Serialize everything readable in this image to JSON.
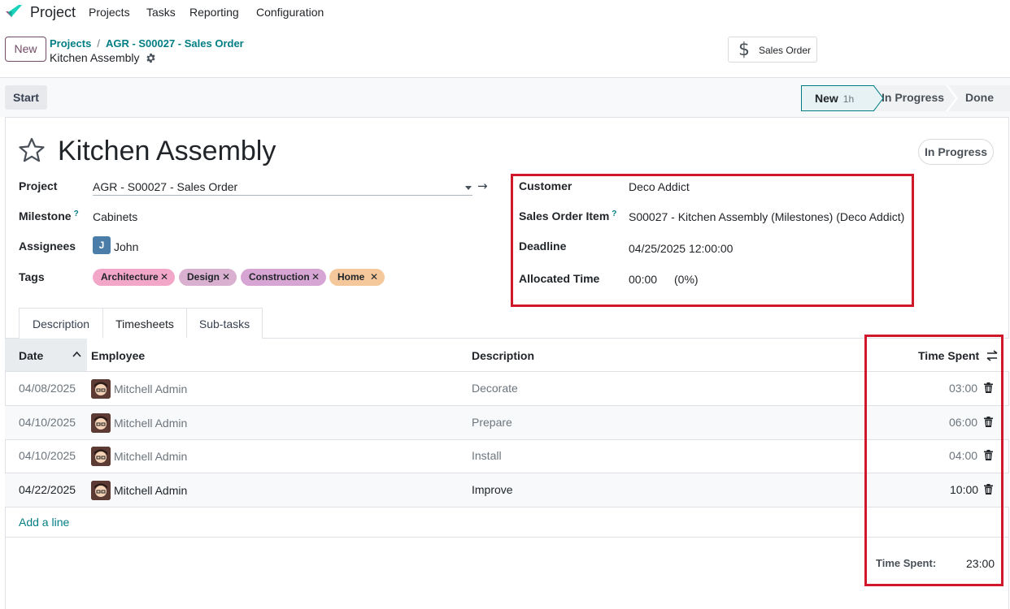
{
  "app": {
    "name": "Project"
  },
  "nav": {
    "items": [
      "Projects",
      "Tasks",
      "Reporting",
      "Configuration"
    ]
  },
  "control": {
    "new_label": "New",
    "breadcrumb": [
      "Projects",
      "AGR - S00027 - Sales Order"
    ],
    "current": "Kitchen Assembly",
    "sales_order_button": "Sales Order"
  },
  "statusbar": {
    "start_label": "Start",
    "stages": [
      {
        "label": "New",
        "duration": "1h",
        "active": true
      },
      {
        "label": "In Progress",
        "active": false
      },
      {
        "label": "Done",
        "active": false
      }
    ]
  },
  "task": {
    "title": "Kitchen Assembly",
    "status_pill": "In Progress",
    "fields": {
      "project_label": "Project",
      "project_value": "AGR - S00027 - Sales Order",
      "milestone_label": "Milestone",
      "milestone_help": "?",
      "milestone_value": "Cabinets",
      "assignees_label": "Assignees",
      "assignee_initial": "J",
      "assignee_name": "John",
      "tags_label": "Tags",
      "customer_label": "Customer",
      "customer_value": "Deco Addict",
      "soi_label": "Sales Order Item",
      "soi_help": "?",
      "soi_value": "S00027 - Kitchen Assembly (Milestones) (Deco Addict)",
      "deadline_label": "Deadline",
      "deadline_value": "04/25/2025 12:00:00",
      "allocated_label": "Allocated Time",
      "allocated_value": "00:00",
      "allocated_pct": "(0%)"
    },
    "tags": [
      {
        "label": "Architecture",
        "color": "#f3a7c8"
      },
      {
        "label": "Design",
        "color": "#d9b0d0"
      },
      {
        "label": "Construction",
        "color": "#d7a5d3"
      },
      {
        "label": "Home",
        "color": "#f5c89b"
      }
    ]
  },
  "tabs": [
    "Description",
    "Timesheets",
    "Sub-tasks"
  ],
  "timesheet": {
    "columns": {
      "date": "Date",
      "employee": "Employee",
      "description": "Description",
      "time": "Time Spent"
    },
    "rows": [
      {
        "date": "04/08/2025",
        "employee": "Mitchell Admin",
        "description": "Decorate",
        "time": "03:00"
      },
      {
        "date": "04/10/2025",
        "employee": "Mitchell Admin",
        "description": "Prepare",
        "time": "06:00"
      },
      {
        "date": "04/10/2025",
        "employee": "Mitchell Admin",
        "description": "Install",
        "time": "04:00"
      },
      {
        "date": "04/22/2025",
        "employee": "Mitchell Admin",
        "description": "Improve",
        "time": "10:00"
      }
    ],
    "add_line": "Add a line",
    "total_label": "Time Spent:",
    "total_value": "23:00"
  },
  "colors": {
    "brand": "#714b67",
    "link": "#017e84",
    "highlight": "#d1182a"
  }
}
